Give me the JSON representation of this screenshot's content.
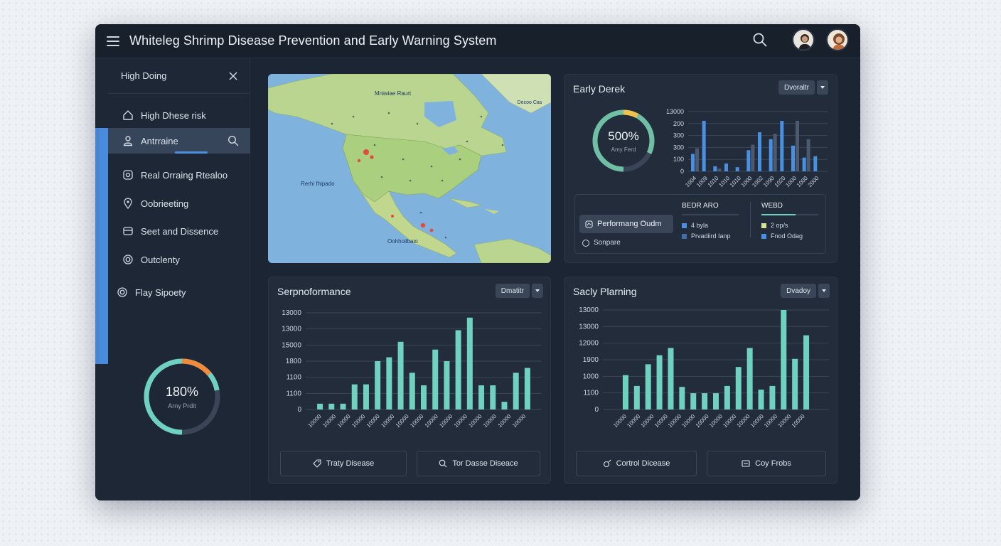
{
  "app": {
    "title": "Whiteleg Shrimp Disease Prevention and Early Warning System"
  },
  "header": {
    "search_icon": "search-icon",
    "avatars": [
      "user-avatar-1",
      "user-avatar-2"
    ]
  },
  "sidebar": {
    "header_label": "High Doing",
    "items": [
      {
        "label": "High Dhese risk",
        "icon": "home-icon"
      },
      {
        "label": "Antrraine",
        "icon": "user-icon",
        "active": true
      },
      {
        "label": "Real Orraing Rtealoo",
        "icon": "target-icon"
      },
      {
        "label": "Oobrieeting",
        "icon": "location-pin-icon"
      },
      {
        "label": "Seet and Dissence",
        "icon": "card-icon"
      },
      {
        "label": "Outclenty",
        "icon": "target-icon"
      },
      {
        "label": "Flay Sipoety",
        "icon": "target-icon"
      }
    ],
    "gauge": {
      "value_label": "180%",
      "sub_label": "Arny Prdit",
      "fraction": 0.72,
      "accent_fraction": 0.14
    }
  },
  "map": {
    "labels": [
      "Mniwiae Raurt",
      "Decoo Cas",
      "Rerhi fhipado",
      "Oohhoilbaio"
    ]
  },
  "early": {
    "title": "Early Derek",
    "dropdown": "Dvoraltr",
    "donut": {
      "value_label": "500%",
      "sub_label": "Amy Ferd",
      "fraction": 0.82,
      "accent_fraction": 0.08
    },
    "legend": {
      "button": "Performang Oudm",
      "radio": "Sonpare",
      "col1": {
        "head": "BEDR ARO",
        "rows": [
          "4 byla",
          "Prvadiird Ianp"
        ]
      },
      "col2": {
        "head": "WEBD",
        "rows": [
          "2 op/s",
          "Fnod Odag"
        ]
      }
    }
  },
  "perf": {
    "title": "Serpnoformance",
    "dropdown": "Dmatitr",
    "buttons": [
      {
        "label": "Traty Disease",
        "icon": "tag-icon"
      },
      {
        "label": "Tor Dasse Diseace",
        "icon": "search-icon"
      }
    ]
  },
  "plan": {
    "title": "Sacly Plarning",
    "dropdown": "Dvadoy",
    "buttons": [
      {
        "label": "Cortrol Dicease",
        "icon": "edit-icon"
      },
      {
        "label": "Coy Frobs",
        "icon": "list-icon"
      }
    ]
  },
  "colors": {
    "accent": "#4d8fe0",
    "teal": "#6fd1c0",
    "bar_blue": "#4a90e2",
    "bar_slate": "#4c5a70"
  },
  "chart_data": [
    {
      "type": "bar",
      "title": "Early Derek",
      "y_ticks": [
        "13000",
        "200",
        "300",
        "300",
        "100",
        "0"
      ],
      "categories": [
        "1004",
        "1009",
        "1010",
        "1010",
        "1010",
        "1000",
        "1002",
        "1090",
        "1020",
        "1000",
        "1000",
        "2000"
      ],
      "series": [
        {
          "values": [
            380,
            1100,
            110,
            170,
            90,
            460,
            850,
            700,
            1100,
            560,
            300,
            330
          ],
          "color": "#4a90e2"
        },
        {
          "values": [
            500,
            0,
            60,
            0,
            0,
            580,
            0,
            820,
            0,
            1100,
            700,
            0
          ],
          "color": "#4c5a70"
        }
      ],
      "ylim": [
        0,
        1300
      ]
    },
    {
      "type": "bar",
      "title": "Serpnoformance",
      "y_ticks": [
        "13000",
        "13000",
        "15000",
        "1800",
        "1100",
        "1100",
        "0"
      ],
      "categories": [
        "10000",
        "10000",
        "10000",
        "10000",
        "10000",
        "10000",
        "10000",
        "10000",
        "10000",
        "10000",
        "10000",
        "10000",
        "10000",
        "10000",
        "10000"
      ],
      "values": [
        60,
        60,
        60,
        260,
        260,
        500,
        540,
        700,
        380,
        250,
        620,
        500,
        820,
        950,
        250,
        250,
        80,
        380,
        430
      ],
      "ylim": [
        0,
        1000
      ]
    },
    {
      "type": "bar",
      "title": "Sacly Plarning",
      "y_ticks": [
        "13000",
        "13000",
        "12000",
        "1900",
        "1000",
        "1100",
        "0"
      ],
      "categories": [
        "10000",
        "10000",
        "10000",
        "10000",
        "10000",
        "10000",
        "10000",
        "10000",
        "10000",
        "10000",
        "10000",
        "10000",
        "10000",
        "10000"
      ],
      "values": [
        380,
        260,
        500,
        600,
        680,
        250,
        180,
        180,
        180,
        260,
        470,
        680,
        220,
        260,
        1100,
        560,
        820
      ],
      "ylim": [
        0,
        1100
      ]
    }
  ]
}
